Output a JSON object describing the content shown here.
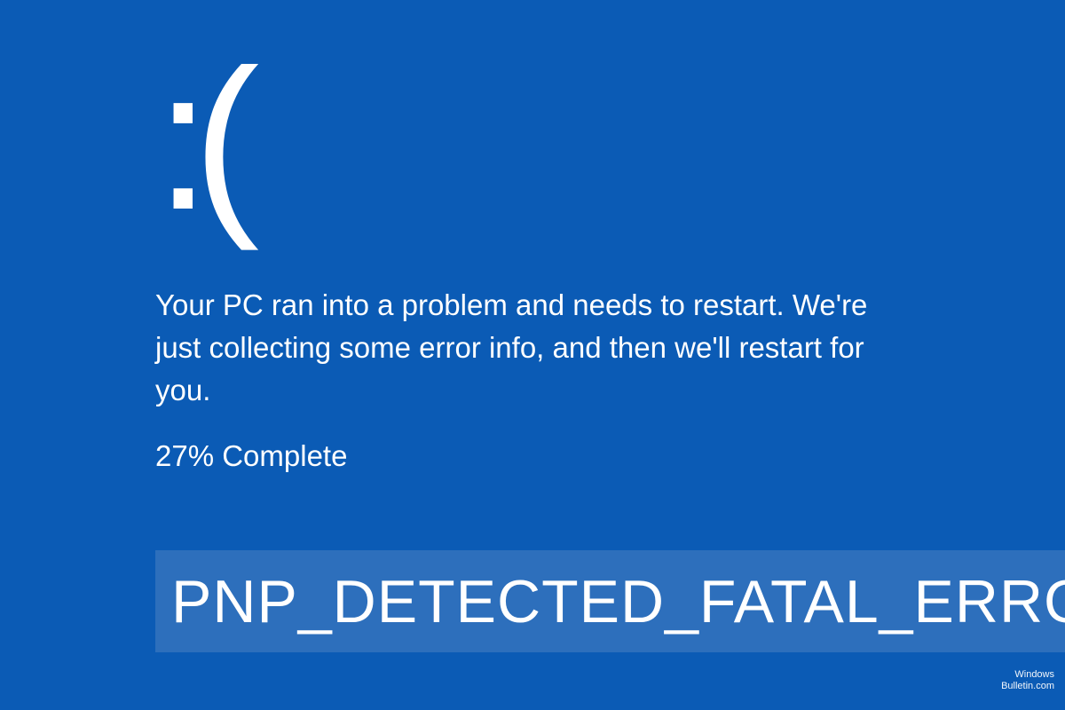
{
  "bsod": {
    "sad_face": ":(",
    "message": "Your PC ran into a problem and needs to restart. We're just collecting some error info, and then we'll restart for you.",
    "progress": "27% Complete",
    "error_code": "PNP_DETECTED_FATAL_ERROR"
  },
  "watermark": {
    "line1": "Windows",
    "line2": "Bulletin.com"
  }
}
